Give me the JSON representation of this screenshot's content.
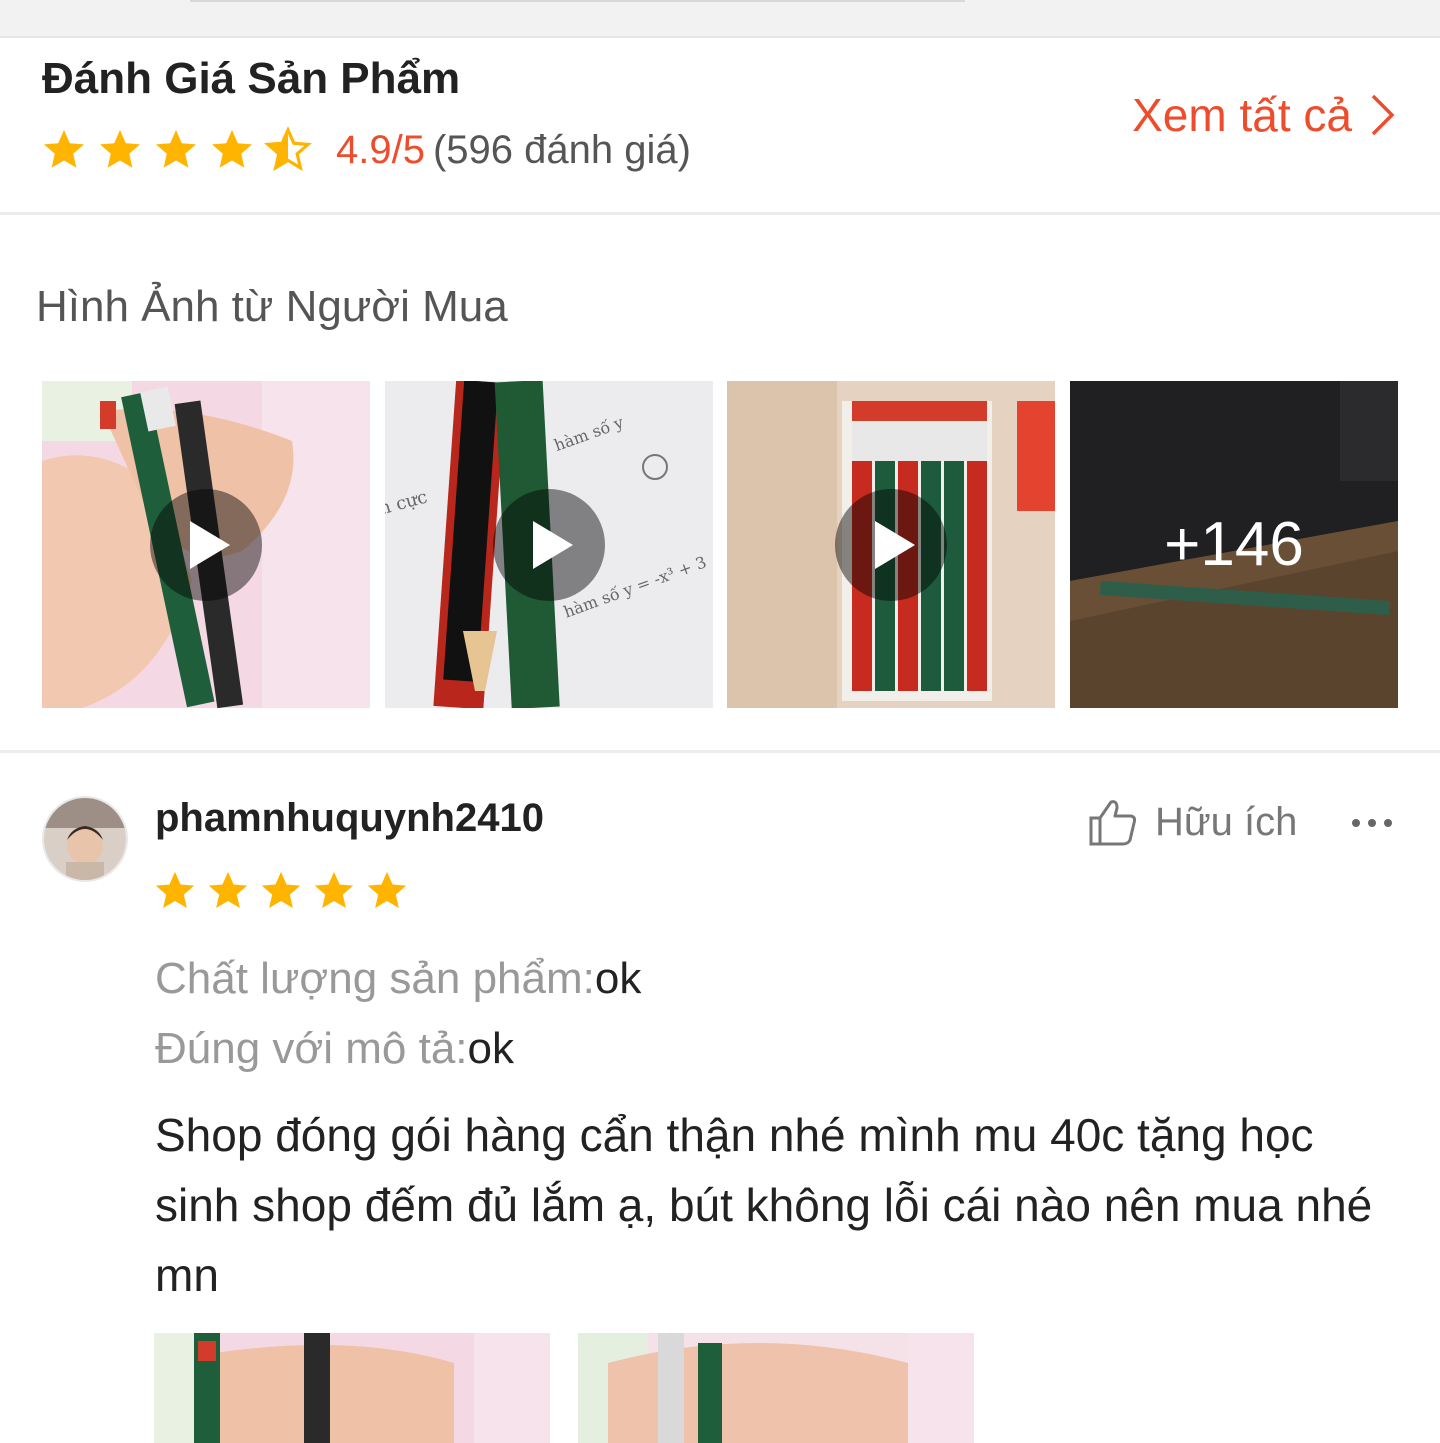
{
  "rating": {
    "title": "Đánh Giá Sản Phẩm",
    "score": "4.9/5",
    "count": "(596 đánh giá)",
    "stars": 4.5,
    "see_all": "Xem tất cả",
    "accent": "#ee4d2d",
    "star_color": "#ffb400"
  },
  "photos": {
    "title": "Hình Ảnh từ Người Mua",
    "items": [
      {
        "type": "video",
        "icon": "play-icon"
      },
      {
        "type": "video",
        "icon": "play-icon"
      },
      {
        "type": "video",
        "icon": "play-icon"
      },
      {
        "type": "image",
        "more": "+146"
      }
    ]
  },
  "review": {
    "username": "phamnhuquynh2410",
    "stars": 5,
    "helpful_label": "Hữu ích",
    "attributes": [
      {
        "label": "Chất lượng sản phẩm:",
        "value": "ok"
      },
      {
        "label": "Đúng với mô tả:",
        "value": "ok"
      }
    ],
    "comment": "Shop đóng gói hàng cẩn thận nhé mình mu 40c tặng học sinh shop đếm đủ lắm ạ, bút không lỗi cái nào nên mua nhé mn"
  }
}
